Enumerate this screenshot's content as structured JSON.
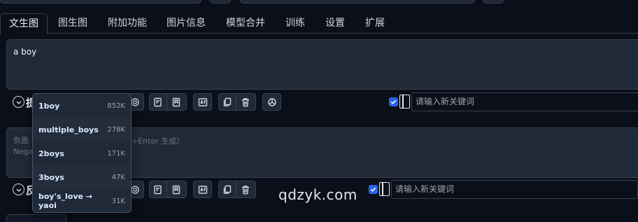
{
  "tabs": [
    {
      "label": "文生图",
      "active": true
    },
    {
      "label": "图生图"
    },
    {
      "label": "附加功能"
    },
    {
      "label": "图片信息"
    },
    {
      "label": "模型合并"
    },
    {
      "label": "训练"
    },
    {
      "label": "设置"
    },
    {
      "label": "扩展"
    }
  ],
  "prompt": {
    "value": "a boy",
    "row_label": "提"
  },
  "negative_prompt": {
    "placeholder_line1": "负面",
    "placeholder_line2": "Nega",
    "placeholder_tail": "+Enter 生成）",
    "row_label": "反"
  },
  "keyword_input": {
    "placeholder": "请输入新关键词"
  },
  "autocomplete": {
    "items": [
      {
        "tag": "1boy",
        "count": "852K"
      },
      {
        "tag": "multiple_boys",
        "count": "278K"
      },
      {
        "tag": "2boys",
        "count": "171K"
      },
      {
        "tag": "3boys",
        "count": "47K"
      },
      {
        "tag": "boy's_love → yaoi",
        "count": "31K"
      }
    ]
  },
  "watermark": "qdzyk.com",
  "colors": {
    "background": "#0b0f19",
    "panel": "#1f2937",
    "border": "#374151",
    "checkbox": "#2563eb"
  }
}
